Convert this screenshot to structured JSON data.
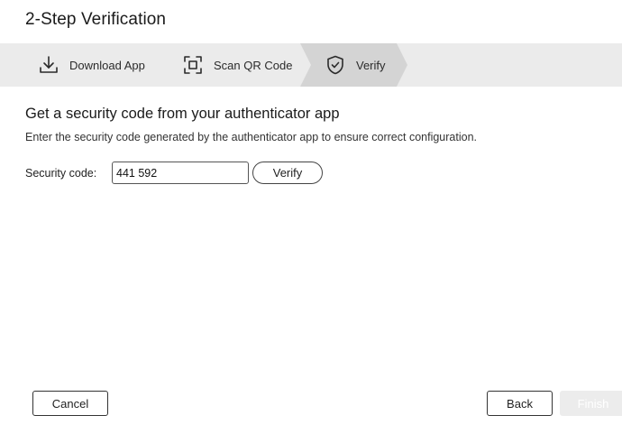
{
  "window": {
    "title": "2-Step Verification"
  },
  "steps": [
    {
      "label": "Download App",
      "icon": "download-icon",
      "active": false
    },
    {
      "label": "Scan QR Code",
      "icon": "qr-scan-icon",
      "active": false
    },
    {
      "label": "Verify",
      "icon": "shield-check-icon",
      "active": true
    }
  ],
  "content": {
    "heading": "Get a security code from your authenticator app",
    "description": "Enter the security code generated by the authenticator app to ensure correct configuration.",
    "code_label": "Security code:",
    "code_value": "441 592",
    "verify_label": "Verify"
  },
  "footer": {
    "cancel_label": "Cancel",
    "back_label": "Back",
    "finish_label": "Finish"
  },
  "colors": {
    "stepbar": "#ebebeb",
    "active_step": "#d4d4d4",
    "finish_disabled": "#ececec"
  }
}
